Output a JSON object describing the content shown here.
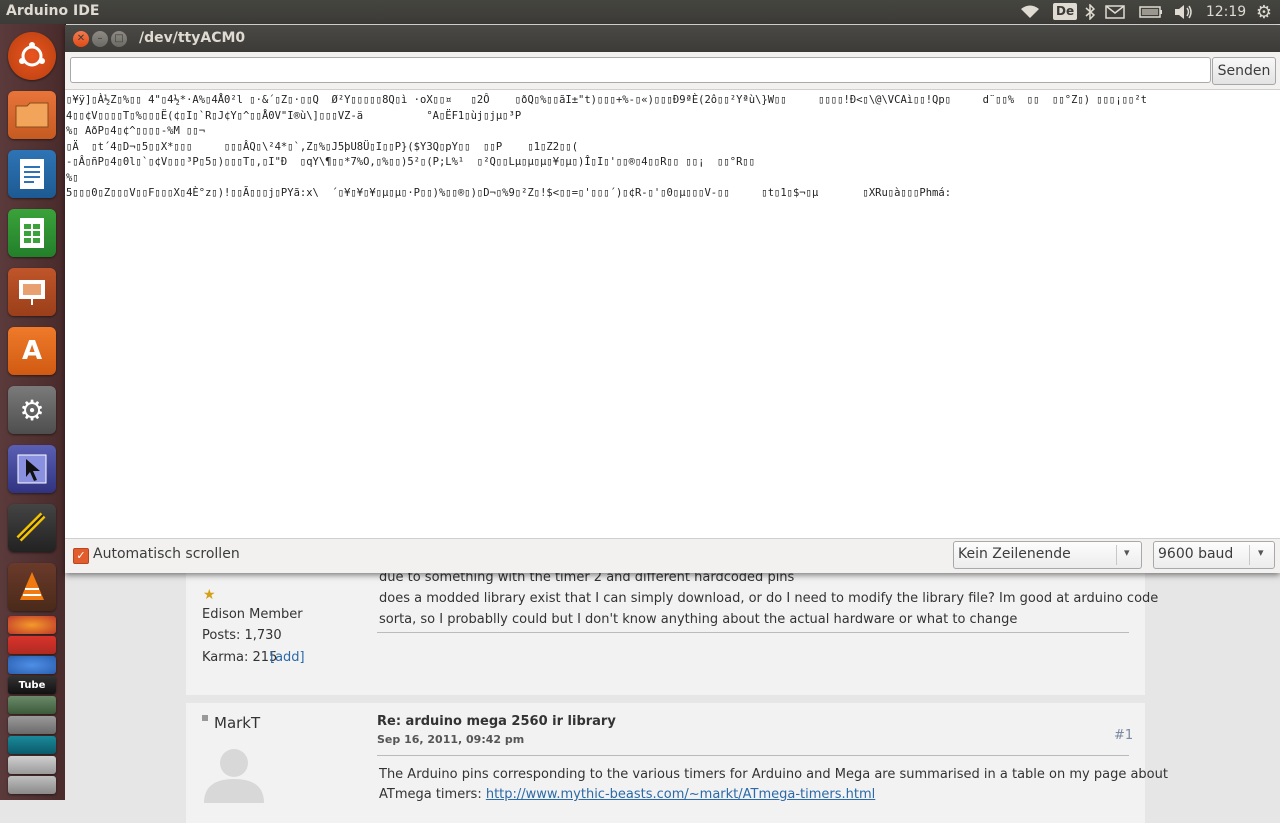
{
  "top_panel": {
    "app_title": "Arduino IDE",
    "keyboard_layout": "De",
    "clock": "12:19",
    "tray_icons": [
      "wifi-icon",
      "keyboard-indicator",
      "bluetooth-icon",
      "mail-icon",
      "battery-icon",
      "volume-icon",
      "gear-icon"
    ]
  },
  "launcher": {
    "items": [
      "ubuntu-dash-icon",
      "files-icon",
      "writer-icon",
      "calc-icon",
      "impress-icon",
      "software-center-icon",
      "system-settings-icon",
      "workspace-switcher-icon",
      "terminal-icon",
      "vlc-icon",
      "firefox-icon",
      "chrome-icon",
      "youtube-icon",
      "arduino-icon"
    ]
  },
  "window": {
    "title": "/dev/ttyACM0",
    "input_value": "",
    "send_label": "Senden",
    "output_lines": [
      "▯¥ÿ]▯À½Z▯%▯▯ 4\"▯4½*·A%▯4Å0²l ▯·&´▯Z▯·▯▯Q  Ø²Y▯▯▯▯▯8Q▯ì ·oX▯▯¤   ▯2Ô    ▯ðQ▯%▯▯ãI±\"t)▯▯▯+%-▯«)▯▯▯Ð9ªÈ(2ô▯▯²Yªù\\}W▯▯     ▯▯▯▯!Ð<▯\\@\\VCAì▯▯!Qp▯     d¨▯▯%  ▯▯  ▯▯°Z▯) ▯▯▯¡▯▯²t",
      "4▯▯¢V▯▯▯▯T▯%▯▯▯Ë(¢▯I▯`R▯J¢Y▯^▯▯Å0V\"I®ù\\]▯▯▯VZ-ä          °A▯ËF1▯ùj▯jµ▯³P",
      "%▯ AðP▯4▯¢^▯▯▯▯-%M ▯▯¬",
      "▯Ä  ▯t´4▯D¬▯5▯▯X*▯▯▯     ▯▯▯ÂQ▯\\²4*▯`,Z▯%▯J5þU8Ü▯I▯▯P}($Y3Q▯pY▯▯  ▯▯P    ▯1▯Z2▯▯(",
      "-▯Â▯ñP▯4▯0l▯`▯¢V▯▯▯³P▯5▯)▯▯▯T▯,▯I\"Ð  ▯qY\\¶▯▯*7%O,▯%▯▯)5²▯(P;L%¹  ▯²Q▯▯Lµ▯µ▯µ▯¥▯µ▯)Î▯I▯'▯▯®▯4▯▯R▯▯ ▯▯¡  ▯▯°R▯▯",
      "%▯",
      "5▯▯▯0▯Z▯▯▯V▯▯F▯▯▯X▯4È°z▯)!▯▯Ã▯▯▯j▯PYã:x\\  ´▯¥▯¥▯¥▯µ▯µ▯·P▯▯)%▯▯®▯)▯D¬▯%9▯²Z▯!$<▯▯=▯'▯▯▯´)▯¢R-▯'▯0▯µ▯▯▯V-▯▯     ▯t▯1▯$¬▯µ       ▯XRu▯à▯▯▯Phmá:"
    ],
    "autoscroll_label": "Automatisch scrollen",
    "autoscroll_checked": true,
    "line_ending": "Kein Zeilenende",
    "baud_rate": "9600 baud"
  },
  "forum": {
    "post0": {
      "member_rank": "Edison Member",
      "posts": "Posts: 1,730",
      "karma": "Karma: 215",
      "karma_add": "[add]",
      "body_lines": [
        "due to something with the timer 2 and different hardcoded pins",
        "does a modded library exist that I can simply download, or do I need to modify the library file? Im good at arduino code",
        "sorta, so I probablly could but I don't know anything about the actual hardware or what to change"
      ]
    },
    "post1": {
      "author": "MarkT",
      "subject": "Re: arduino mega 2560 ir library",
      "date": "Sep 16, 2011, 09:42 pm",
      "post_number": "#1",
      "body_line1": "The Arduino pins corresponding to the various timers for Arduino and Mega are summarised in a table on my page about",
      "body_line2_prefix": "ATmega timers: ",
      "body_link": "http://www.mythic-beasts.com/~markt/ATmega-timers.html"
    }
  }
}
